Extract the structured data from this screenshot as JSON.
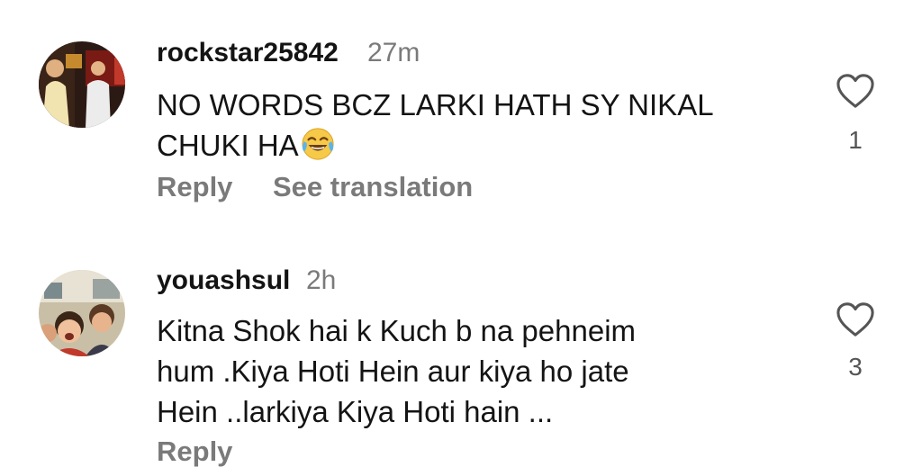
{
  "comments": [
    {
      "username": "rockstar25842",
      "time": "27m",
      "text_line1": "NO WORDS BCZ LARKI HATH SY NIKAL",
      "text_line2": "CHUKI HA",
      "emoji": "face-with-tears-of-joy",
      "likes": "1",
      "reply_label": "Reply",
      "translate_label": "See translation"
    },
    {
      "username": "youashsul",
      "time": "2h",
      "text_line1": "Kitna Shok hai k Kuch b na pehneim",
      "text_line2": "hum .Kiya Hoti Hein aur kiya ho jate",
      "text_line3": "Hein ..larkiya Kiya Hoti hain ...",
      "likes": "3",
      "reply_label": "Reply"
    }
  ],
  "colors": {
    "primary_text": "#141414",
    "secondary_text": "#7a7a7a",
    "background": "#ffffff"
  },
  "icons": {
    "like": "heart-outline-icon",
    "emoji": "face-with-tears-of-joy"
  }
}
